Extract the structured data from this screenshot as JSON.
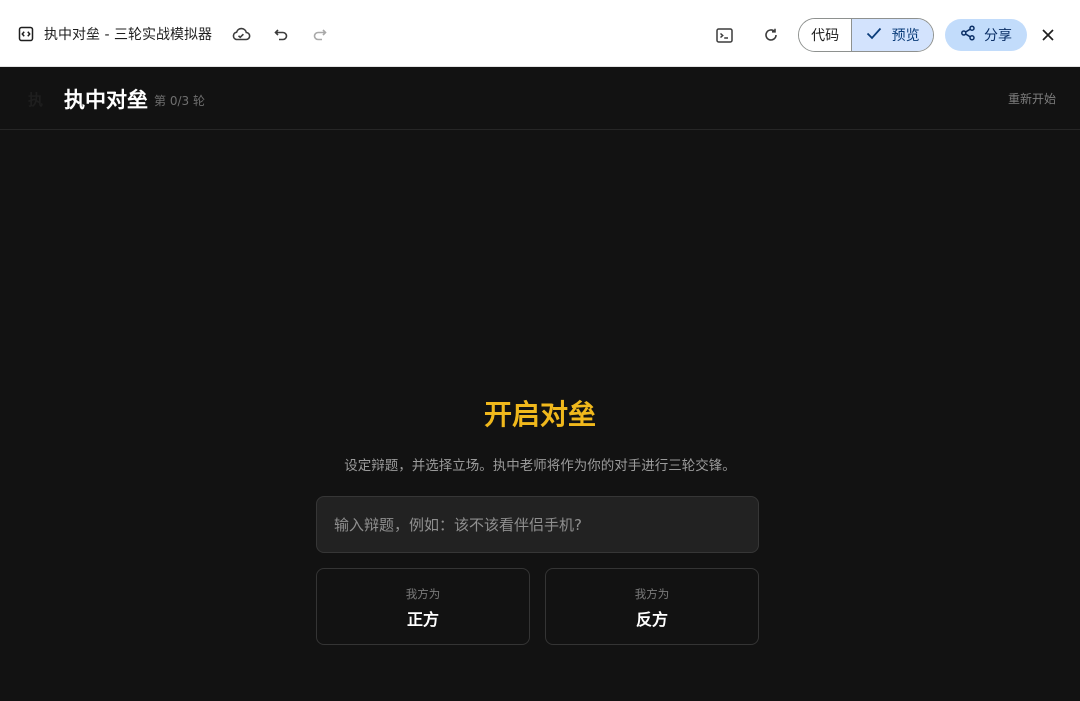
{
  "chrome": {
    "title": "执中对垒 - 三轮实战模拟器",
    "code_label": "代码",
    "preview_label": "预览",
    "share_label": "分享",
    "icons": [
      "code-window-icon",
      "cloud-icon",
      "undo-icon",
      "redo-icon",
      "terminal-icon",
      "refresh-icon",
      "check-icon",
      "share-icon",
      "close-icon"
    ]
  },
  "app": {
    "logo": "执",
    "title": "执中对垒",
    "round": "第 0/3 轮",
    "restart": "重新开始",
    "headline": "开启对垒",
    "description": "设定辩题，并选择立场。执中老师将作为你的对手进行三轮交锋。",
    "topic_placeholder": "输入辩题，例如：该不该看伴侣手机?",
    "side_prefix": "我方为",
    "pro": "正方",
    "con": "反方"
  },
  "colors": {
    "accent": "#f0b81c",
    "background": "#121212",
    "preview_active": "#d3e3fd",
    "share_button": "#c2dcfb"
  }
}
